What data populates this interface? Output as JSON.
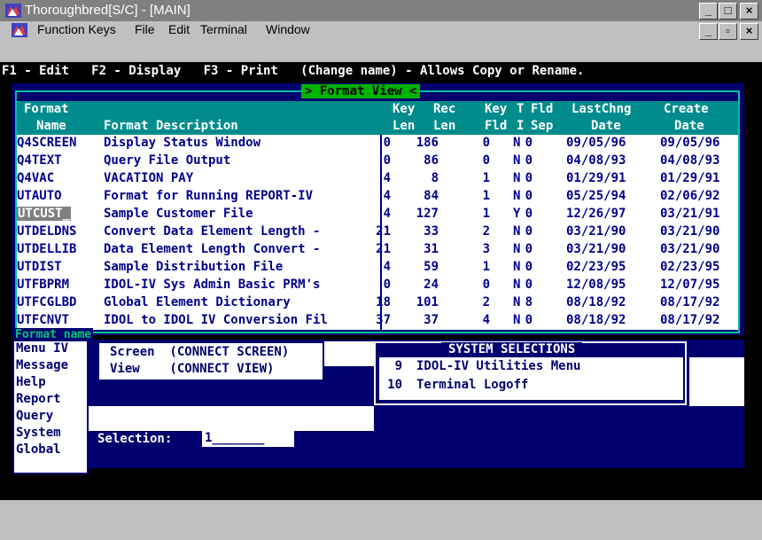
{
  "window": {
    "title": "Thoroughbred[S/C] - [MAIN]",
    "min_label": "_",
    "max_label": "□",
    "close_label": "×",
    "mdi_min_label": "_",
    "mdi_restore_label": "▫",
    "mdi_close_label": "×"
  },
  "menubar": [
    "Function Keys",
    "File",
    "Edit",
    "Terminal",
    "Window"
  ],
  "fkeys_line": "F1 - Edit   F2 - Display   F3 - Print   (Change name) - Allows Copy or Rename.",
  "format_view_title": "> Format View <",
  "table": {
    "headers_line1": [
      "Format",
      "",
      "Key",
      "Rec",
      "Key",
      "T",
      "Fld",
      "LastChng",
      "Create"
    ],
    "headers_line2": [
      "Name",
      "Format Description",
      "Len",
      "Len",
      "Fld",
      "I",
      "Sep",
      "Date",
      "Date"
    ],
    "rows": [
      {
        "name": "Q4SCREEN",
        "desc": "Display Status Window",
        "keylen": "0",
        "reclen": "186",
        "keyfld": "0",
        "ti": "N",
        "sep": "0",
        "lastchng": "09/05/96",
        "create": "09/05/96"
      },
      {
        "name": "Q4TEXT",
        "desc": "Query File Output",
        "keylen": "0",
        "reclen": "86",
        "keyfld": "0",
        "ti": "N",
        "sep": "0",
        "lastchng": "04/08/93",
        "create": "04/08/93"
      },
      {
        "name": "Q4VAC",
        "desc": "VACATION PAY",
        "keylen": "4",
        "reclen": "8",
        "keyfld": "1",
        "ti": "N",
        "sep": "0",
        "lastchng": "01/29/91",
        "create": "01/29/91"
      },
      {
        "name": "UTAUTO",
        "desc": "Format for Running REPORT-IV",
        "keylen": "4",
        "reclen": "84",
        "keyfld": "1",
        "ti": "N",
        "sep": "0",
        "lastchng": "05/25/94",
        "create": "02/06/92"
      },
      {
        "name": "UTCUST_",
        "desc": "Sample Customer File",
        "keylen": "4",
        "reclen": "127",
        "keyfld": "1",
        "ti": "Y",
        "sep": "0",
        "lastchng": "12/26/97",
        "create": "03/21/91"
      },
      {
        "name": "UTDELDNS",
        "desc": "Convert Data Element Length -",
        "keylen": "21",
        "reclen": "33",
        "keyfld": "2",
        "ti": "N",
        "sep": "0",
        "lastchng": "03/21/90",
        "create": "03/21/90"
      },
      {
        "name": "UTDELLIB",
        "desc": "Data Element Length Convert -",
        "keylen": "21",
        "reclen": "31",
        "keyfld": "3",
        "ti": "N",
        "sep": "0",
        "lastchng": "03/21/90",
        "create": "03/21/90"
      },
      {
        "name": "UTDIST",
        "desc": "Sample Distribution File",
        "keylen": "4",
        "reclen": "59",
        "keyfld": "1",
        "ti": "N",
        "sep": "0",
        "lastchng": "02/23/95",
        "create": "02/23/95"
      },
      {
        "name": "UTFBPRM",
        "desc": "IDOL-IV Sys Admin Basic PRM's",
        "keylen": "0",
        "reclen": "24",
        "keyfld": "0",
        "ti": "N",
        "sep": "0",
        "lastchng": "12/08/95",
        "create": "12/07/95"
      },
      {
        "name": "UTFCGLBD",
        "desc": "Global Element Dictionary",
        "keylen": "18",
        "reclen": "101",
        "keyfld": "2",
        "ti": "N",
        "sep": "8",
        "lastchng": "08/18/92",
        "create": "08/17/92"
      },
      {
        "name": "UTFCNVT",
        "desc": "IDOL to IDOL IV Conversion Fil",
        "keylen": "37",
        "reclen": "37",
        "keyfld": "4",
        "ti": "N",
        "sep": "0",
        "lastchng": "08/18/92",
        "create": "08/17/92"
      }
    ]
  },
  "format_name_label": "Format name",
  "side_menu": [
    "Menu IV",
    "Message",
    "Help",
    "Report",
    "Query",
    "System",
    "Global"
  ],
  "connect": [
    "Screen  (CONNECT SCREEN)",
    "View    (CONNECT VIEW)"
  ],
  "system_selections": {
    "title": "SYSTEM SELECTIONS",
    "items": [
      {
        "num": "9",
        "label": "IDOL-IV Utilities Menu"
      },
      {
        "num": "10",
        "label": "Terminal Logoff"
      }
    ]
  },
  "selection": {
    "label": "Selection:",
    "value": "1_______"
  },
  "colors": {
    "navy": "#00006e",
    "teal": "#008c8c",
    "green": "#00b400",
    "gray": "#c0c0c0"
  },
  "icons": [
    "app-icon",
    "mdi-doc-icon"
  ]
}
